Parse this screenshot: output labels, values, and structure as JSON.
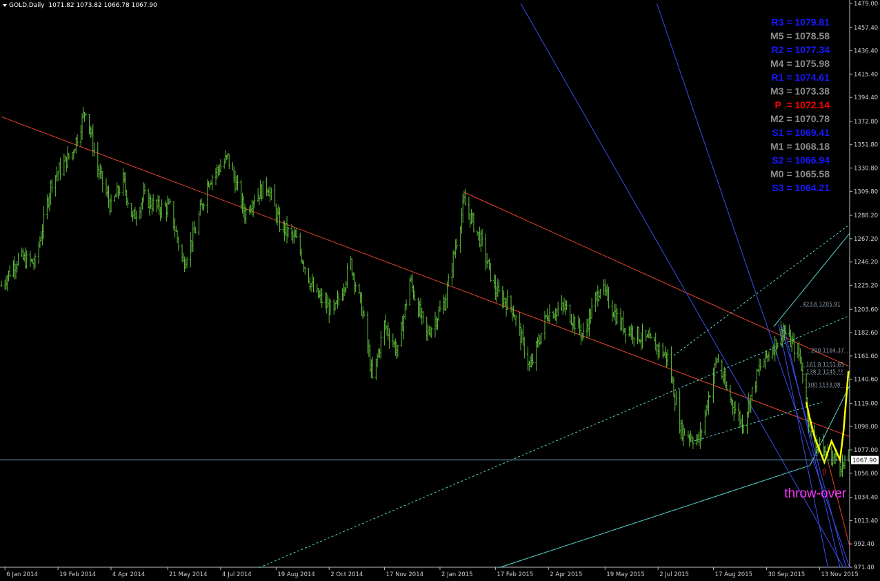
{
  "header": {
    "symbol": "GOLD,Daily",
    "ohlc": "1071.82 1073.82 1066.78 1067.90"
  },
  "colors": {
    "background": "#000000",
    "candles": "#5fbf3b",
    "axis": "#c0c0c0",
    "channel_red": "#e8452c",
    "channel_cyan": "#5ad8d0",
    "fan_blue": "#3a4ff0",
    "zigzag": "#ffff00",
    "annotation": "#ff33ff",
    "pivot_blue": "#1818ff",
    "pivot_gray": "#8c8c8c",
    "pivot_red": "#ff0000",
    "price_line": "#7aa6c4"
  },
  "pivots": [
    {
      "label": "R3",
      "value": "1079.81",
      "color": "#1818ff"
    },
    {
      "label": "M5",
      "value": "1078.58",
      "color": "#8c8c8c"
    },
    {
      "label": "R2",
      "value": "1077.34",
      "color": "#1818ff"
    },
    {
      "label": "M4",
      "value": "1075.98",
      "color": "#8c8c8c"
    },
    {
      "label": "R1",
      "value": "1074.61",
      "color": "#1818ff"
    },
    {
      "label": "M3",
      "value": "1073.38",
      "color": "#8c8c8c"
    },
    {
      "label": "P ",
      "value": "1072.14",
      "color": "#ff0000"
    },
    {
      "label": "M2",
      "value": "1070.78",
      "color": "#8c8c8c"
    },
    {
      "label": "S1",
      "value": "1069.41",
      "color": "#1818ff"
    },
    {
      "label": "M1",
      "value": "1068.18",
      "color": "#8c8c8c"
    },
    {
      "label": "S2",
      "value": "1066.94",
      "color": "#1818ff"
    },
    {
      "label": "M0",
      "value": "1065.58",
      "color": "#8c8c8c"
    },
    {
      "label": "S3",
      "value": "1064.21",
      "color": "#1818ff"
    }
  ],
  "annotation": {
    "text": "throw-over",
    "arrow": "⇧"
  },
  "fib_labels": [
    {
      "text": "423.6 1205.91",
      "price": 1205.9,
      "date": "2015-10-30"
    },
    {
      "text": "200 1164.37",
      "price": 1164.4,
      "date": "2015-11-06"
    },
    {
      "text": "161.8 1151.65",
      "price": 1151.7,
      "date": "2015-11-02"
    },
    {
      "text": "138.2 1145.??",
      "price": 1145.0,
      "date": "2015-11-02"
    },
    {
      "text": "100 1133.08",
      "price": 1133.1,
      "date": "2015-11-03"
    }
  ],
  "chart_data": {
    "type": "bar",
    "symbol": "GOLD",
    "timeframe": "Daily",
    "ylim": [
      971.4,
      1479.0
    ],
    "xlim": [
      "2014-01-03",
      "2015-12-08"
    ],
    "y_ticks": [
      "1479.00",
      "1457.40",
      "1436.40",
      "1415.40",
      "1394.40",
      "1372.80",
      "1351.80",
      "1330.80",
      "1309.80",
      "1288.20",
      "1267.20",
      "1246.20",
      "1225.20",
      "1203.60",
      "1182.60",
      "1161.60",
      "1140.60",
      "1119.00",
      "1098.00",
      "1077.00",
      "1056.00",
      "1034.40",
      "1013.40",
      "992.40",
      "971.40"
    ],
    "x_ticks": [
      {
        "label": "6 Jan 2014",
        "date": "2014-01-06"
      },
      {
        "label": "19 Feb 2014",
        "date": "2014-02-19"
      },
      {
        "label": "4 Apr 2014",
        "date": "2014-04-04"
      },
      {
        "label": "21 May 2014",
        "date": "2014-05-21"
      },
      {
        "label": "4 Jul 2014",
        "date": "2014-07-04"
      },
      {
        "label": "19 Aug 2014",
        "date": "2014-08-19"
      },
      {
        "label": "2 Oct 2014",
        "date": "2014-10-02"
      },
      {
        "label": "17 Nov 2014",
        "date": "2014-11-17"
      },
      {
        "label": "2 Jan 2015",
        "date": "2015-01-02"
      },
      {
        "label": "17 Feb 2015",
        "date": "2015-02-17"
      },
      {
        "label": "2 Apr 2015",
        "date": "2015-04-02"
      },
      {
        "label": "19 May 2015",
        "date": "2015-05-19"
      },
      {
        "label": "2 Jul 2015",
        "date": "2015-07-02"
      },
      {
        "label": "17 Aug 2015",
        "date": "2015-08-17"
      },
      {
        "label": "30 Sep 2015",
        "date": "2015-09-30"
      },
      {
        "label": "13 Nov 2015",
        "date": "2015-11-13"
      }
    ],
    "current_price": "1067.90",
    "price_path": [
      [
        "2014-01-03",
        1225
      ],
      [
        "2014-01-17",
        1250
      ],
      [
        "2014-01-31",
        1245
      ],
      [
        "2014-02-14",
        1320
      ],
      [
        "2014-03-03",
        1345
      ],
      [
        "2014-03-14",
        1385
      ],
      [
        "2014-03-24",
        1330
      ],
      [
        "2014-04-04",
        1295
      ],
      [
        "2014-04-14",
        1320
      ],
      [
        "2014-04-22",
        1285
      ],
      [
        "2014-05-01",
        1305
      ],
      [
        "2014-05-12",
        1295
      ],
      [
        "2014-05-23",
        1295
      ],
      [
        "2014-06-03",
        1245
      ],
      [
        "2014-06-13",
        1275
      ],
      [
        "2014-06-24",
        1320
      ],
      [
        "2014-07-10",
        1340
      ],
      [
        "2014-07-24",
        1290
      ],
      [
        "2014-08-01",
        1305
      ],
      [
        "2014-08-12",
        1315
      ],
      [
        "2014-08-22",
        1280
      ],
      [
        "2014-09-05",
        1265
      ],
      [
        "2014-09-19",
        1220
      ],
      [
        "2014-10-06",
        1200
      ],
      [
        "2014-10-20",
        1245
      ],
      [
        "2014-10-30",
        1200
      ],
      [
        "2014-11-07",
        1140
      ],
      [
        "2014-11-17",
        1190
      ],
      [
        "2014-11-28",
        1165
      ],
      [
        "2014-12-08",
        1230
      ],
      [
        "2014-12-22",
        1180
      ],
      [
        "2015-01-06",
        1210
      ],
      [
        "2015-01-22",
        1300
      ],
      [
        "2015-02-05",
        1265
      ],
      [
        "2015-02-17",
        1220
      ],
      [
        "2015-03-03",
        1205
      ],
      [
        "2015-03-18",
        1150
      ],
      [
        "2015-04-01",
        1200
      ],
      [
        "2015-04-16",
        1205
      ],
      [
        "2015-05-01",
        1180
      ],
      [
        "2015-05-15",
        1225
      ],
      [
        "2015-06-01",
        1190
      ],
      [
        "2015-06-16",
        1180
      ],
      [
        "2015-07-01",
        1170
      ],
      [
        "2015-07-10",
        1160
      ],
      [
        "2015-07-21",
        1095
      ],
      [
        "2015-08-05",
        1085
      ],
      [
        "2015-08-20",
        1160
      ],
      [
        "2015-08-28",
        1130
      ],
      [
        "2015-09-10",
        1100
      ],
      [
        "2015-09-24",
        1150
      ],
      [
        "2015-10-14",
        1185
      ],
      [
        "2015-10-28",
        1160
      ],
      [
        "2015-11-06",
        1090
      ],
      [
        "2015-11-17",
        1075
      ],
      [
        "2015-11-25",
        1070
      ],
      [
        "2015-12-03",
        1062
      ],
      [
        "2015-12-07",
        1068
      ]
    ],
    "zigzag": [
      [
        "2015-11-02",
        1120
      ],
      [
        "2015-11-05",
        1105
      ],
      [
        "2015-11-09",
        1088
      ],
      [
        "2015-11-17",
        1066
      ],
      [
        "2015-11-23",
        1085
      ],
      [
        "2015-11-30",
        1068
      ],
      [
        "2015-12-03",
        1095
      ],
      [
        "2015-12-07",
        1148
      ]
    ],
    "trendlines": [
      {
        "color": "red",
        "from": [
          "2014-01-03",
          1377
        ],
        "to": [
          "2015-12-08",
          1089
        ]
      },
      {
        "color": "red",
        "from": [
          "2015-01-22",
          1309
        ],
        "to": [
          "2015-12-08",
          1152
        ]
      },
      {
        "color": "red",
        "from": [
          "2015-11-20",
          1067
        ],
        "to": [
          "2015-12-08",
          990
        ]
      },
      {
        "color": "cyan",
        "from": [
          "2015-10-06",
          1188
        ],
        "to": [
          "2015-12-08",
          1272
        ]
      },
      {
        "color": "cyan",
        "from": [
          "2015-11-05",
          1063
        ],
        "to": [
          "2015-12-08",
          1135
        ]
      },
      {
        "color": "cyan",
        "from": [
          "2015-02-20",
          971
        ],
        "to": [
          "2015-11-05",
          1063
        ]
      },
      {
        "color": "cyan",
        "dashed": true,
        "from": [
          "2014-08-05",
          971
        ],
        "to": [
          "2015-12-08",
          1198
        ]
      },
      {
        "color": "cyan",
        "dashed": true,
        "from": [
          "2015-07-15",
          1162
        ],
        "to": [
          "2015-12-08",
          1280
        ]
      },
      {
        "color": "cyan",
        "dashed": true,
        "from": [
          "2015-08-01",
          1085
        ],
        "to": [
          "2015-11-15",
          1120
        ]
      }
    ],
    "fan_lines": [
      {
        "from": [
          "2015-03-10",
          1479
        ],
        "to": [
          "2015-12-03",
          971
        ]
      },
      {
        "from": [
          "2015-07-01",
          1479
        ],
        "to": [
          "2015-12-08",
          971
        ]
      },
      {
        "from": [
          "2015-10-10",
          1190
        ],
        "to": [
          "2015-11-20",
          971
        ]
      },
      {
        "from": [
          "2015-10-12",
          1190
        ],
        "to": [
          "2015-12-05",
          971
        ]
      },
      {
        "from": [
          "2015-10-14",
          1190
        ],
        "to": [
          "2015-11-30",
          971
        ]
      }
    ]
  }
}
